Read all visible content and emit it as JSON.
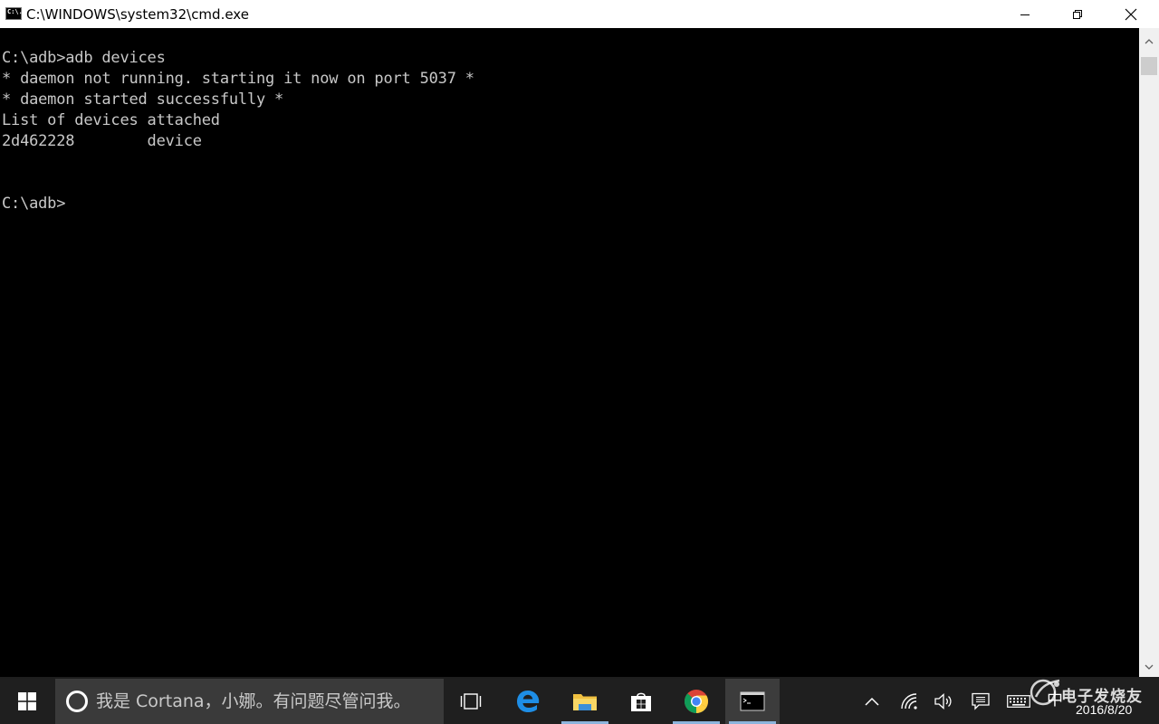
{
  "window": {
    "title": "C:\\WINDOWS\\system32\\cmd.exe",
    "icon_label": "C:\\."
  },
  "console": {
    "lines": [
      "C:\\adb>adb devices",
      "* daemon not running. starting it now on port 5037 *",
      "* daemon started successfully *",
      "List of devices attached",
      "2d462228        device",
      "",
      "",
      "C:\\adb>"
    ]
  },
  "taskbar": {
    "search_placeholder": "我是 Cortana，小娜。有问题尽管问我。",
    "apps": [
      "task-view",
      "edge",
      "file-explorer",
      "store",
      "chrome",
      "command-prompt"
    ],
    "accent_color": "#8cb4dc",
    "tray": {
      "language": "中",
      "date": "2016/8/20"
    }
  },
  "watermark": {
    "text": "电子发烧友"
  }
}
